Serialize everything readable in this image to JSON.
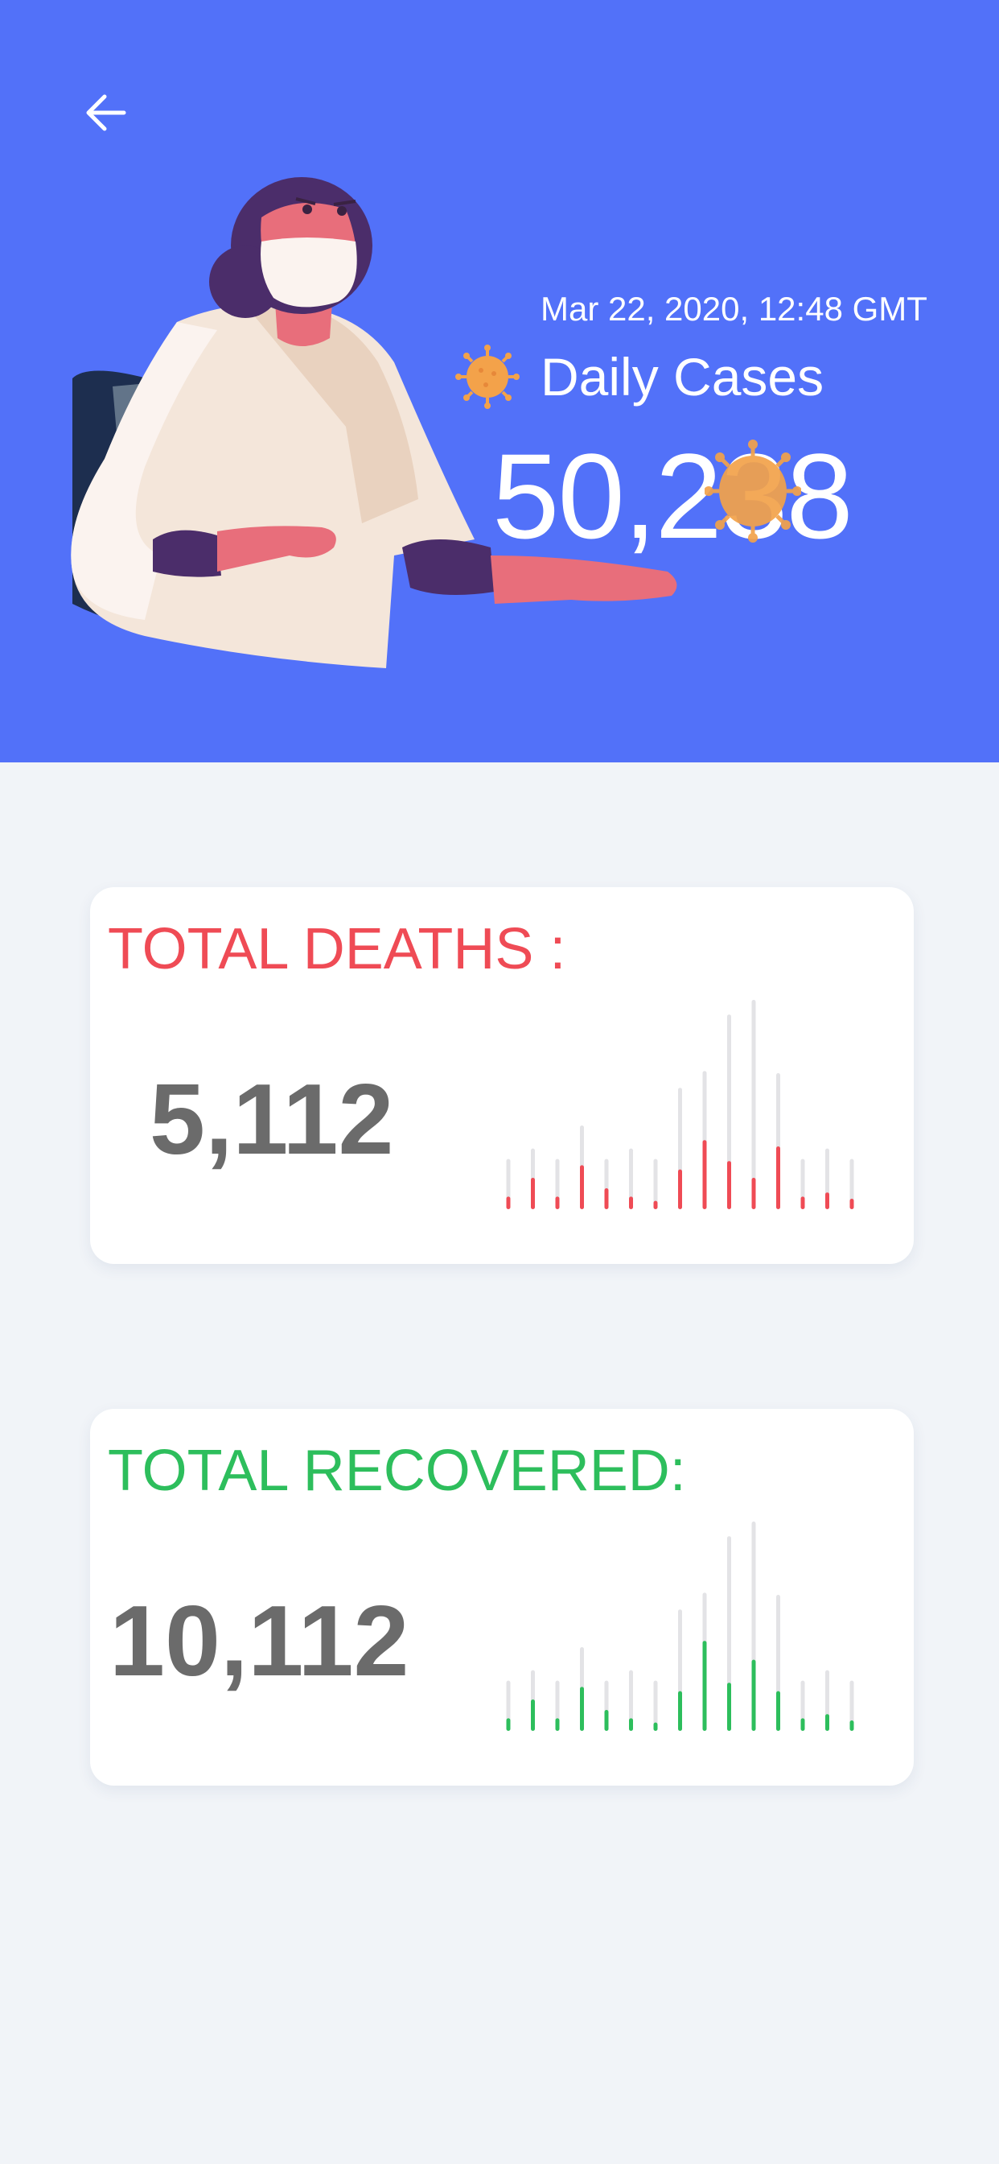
{
  "colors": {
    "header_bg": "#5271f9",
    "page_bg": "#f1f4f8",
    "deaths": "#ef4b55",
    "recovered": "#2dbe5c",
    "value_text": "#6b6b6b",
    "bar_track": "#e3e3e6",
    "virus": "#f3a24a"
  },
  "header": {
    "back_icon": "arrow-left-icon",
    "timestamp": "Mar 22, 2020, 12:48 GMT",
    "daily_label": "Daily Cases",
    "daily_value": "50,238",
    "virus_icon": "virus-icon"
  },
  "deaths": {
    "title": "TOTAL DEATHS :",
    "value": "5,112",
    "bars": [
      {
        "bg": 0.24,
        "fg": 0.06
      },
      {
        "bg": 0.29,
        "fg": 0.15
      },
      {
        "bg": 0.24,
        "fg": 0.06
      },
      {
        "bg": 0.4,
        "fg": 0.21
      },
      {
        "bg": 0.24,
        "fg": 0.1
      },
      {
        "bg": 0.29,
        "fg": 0.06
      },
      {
        "bg": 0.24,
        "fg": 0.04
      },
      {
        "bg": 0.58,
        "fg": 0.19
      },
      {
        "bg": 0.66,
        "fg": 0.33
      },
      {
        "bg": 0.93,
        "fg": 0.23
      },
      {
        "bg": 1.0,
        "fg": 0.15
      },
      {
        "bg": 0.65,
        "fg": 0.3
      },
      {
        "bg": 0.24,
        "fg": 0.06
      },
      {
        "bg": 0.29,
        "fg": 0.08
      },
      {
        "bg": 0.24,
        "fg": 0.05
      }
    ]
  },
  "recovered": {
    "title": "TOTAL RECOVERED:",
    "value": "10,112",
    "bars": [
      {
        "bg": 0.24,
        "fg": 0.06
      },
      {
        "bg": 0.29,
        "fg": 0.15
      },
      {
        "bg": 0.24,
        "fg": 0.06
      },
      {
        "bg": 0.4,
        "fg": 0.21
      },
      {
        "bg": 0.24,
        "fg": 0.1
      },
      {
        "bg": 0.29,
        "fg": 0.06
      },
      {
        "bg": 0.24,
        "fg": 0.04
      },
      {
        "bg": 0.58,
        "fg": 0.19
      },
      {
        "bg": 0.66,
        "fg": 0.43
      },
      {
        "bg": 0.93,
        "fg": 0.23
      },
      {
        "bg": 1.0,
        "fg": 0.34
      },
      {
        "bg": 0.65,
        "fg": 0.19
      },
      {
        "bg": 0.24,
        "fg": 0.06
      },
      {
        "bg": 0.29,
        "fg": 0.08
      },
      {
        "bg": 0.24,
        "fg": 0.05
      }
    ]
  }
}
